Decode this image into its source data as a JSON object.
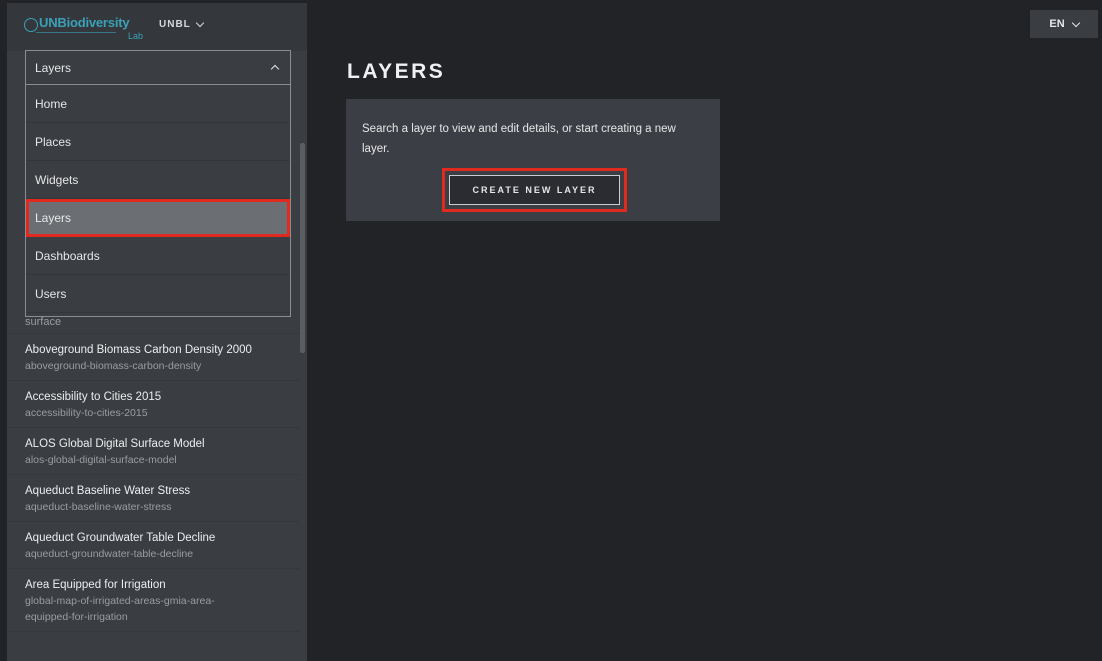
{
  "brand": {
    "logo_text": "UNBiodiversity",
    "logo_sub": "Lab",
    "org_label": "UNBL"
  },
  "section_select": {
    "value": "Layers"
  },
  "menu": {
    "items": [
      {
        "label": "Home"
      },
      {
        "label": "Places"
      },
      {
        "label": "Widgets"
      },
      {
        "label": "Layers"
      },
      {
        "label": "Dashboards"
      },
      {
        "label": "Users"
      }
    ],
    "selected": "Layers"
  },
  "layers": {
    "partial_slug": "surface",
    "items": [
      {
        "name": "Aboveground Biomass Carbon Density 2000",
        "slug": "aboveground-biomass-carbon-density"
      },
      {
        "name": "Accessibility to Cities 2015",
        "slug": "accessibility-to-cities-2015"
      },
      {
        "name": "ALOS Global Digital Surface Model",
        "slug": "alos-global-digital-surface-model"
      },
      {
        "name": "Aqueduct Baseline Water Stress",
        "slug": "aqueduct-baseline-water-stress"
      },
      {
        "name": "Aqueduct Groundwater Table Decline",
        "slug": "aqueduct-groundwater-table-decline"
      },
      {
        "name": "Area Equipped for Irrigation",
        "slug": "global-map-of-irrigated-areas-gmia-area-",
        "slug2": "equipped-for-irrigation"
      }
    ]
  },
  "header": {
    "language": "EN"
  },
  "main": {
    "title": "LAYERS",
    "info_text": "Search a layer to view and edit details, or start creating a new layer.",
    "create_button": "CREATE NEW LAYER"
  },
  "colors": {
    "accent": "#3aa2b8",
    "highlight": "#e0291f",
    "background": "#222327",
    "sidebar": "#3a3d42"
  }
}
